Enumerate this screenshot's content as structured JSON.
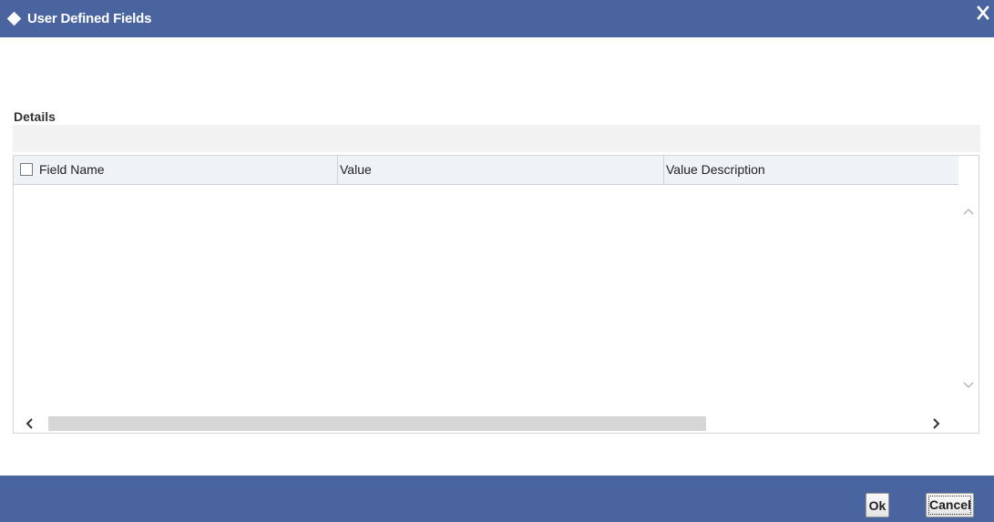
{
  "window": {
    "title": "User Defined Fields",
    "close_icon": "close-icon",
    "title_icon": "diamond-icon",
    "accent_color": "#4a64a0"
  },
  "details": {
    "section_label": "Details",
    "columns": [
      "Field Name",
      "Value",
      "Value Description"
    ],
    "rows": []
  },
  "footer": {
    "ok_label": "Ok",
    "cancel_label": "Cancel"
  }
}
